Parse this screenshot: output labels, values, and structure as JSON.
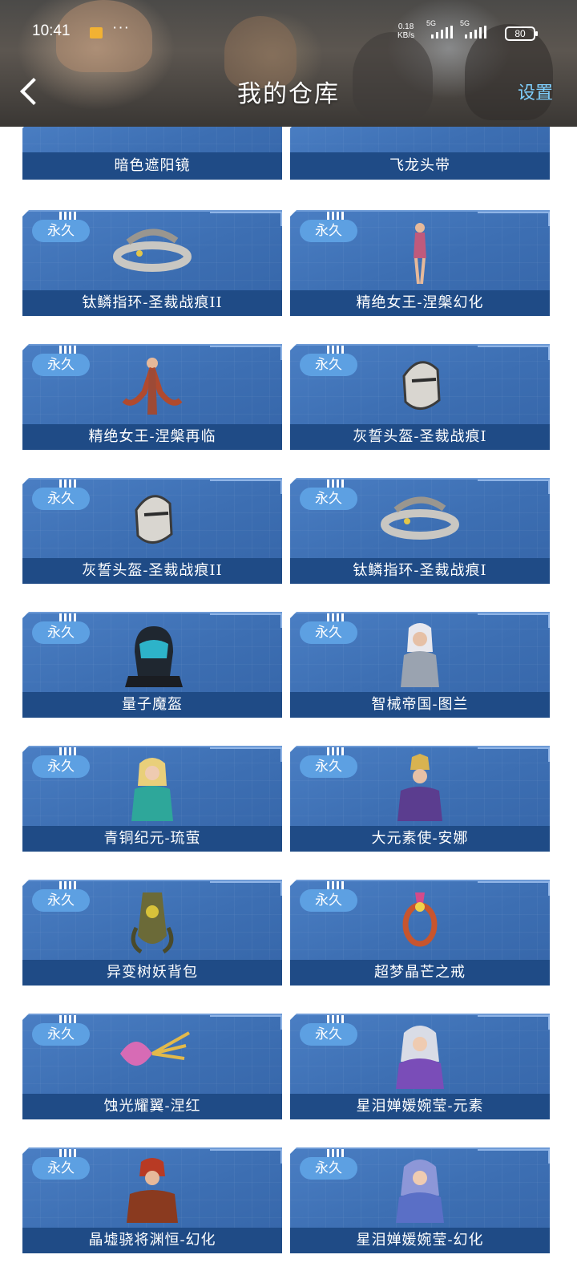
{
  "status": {
    "time": "10:41",
    "dots": "···",
    "speed_value": "0.18",
    "speed_unit": "KB/s",
    "network1": "5G",
    "network2": "5G",
    "battery": "80"
  },
  "header": {
    "title": "我的仓库",
    "settings": "设置"
  },
  "badge_label": "永久",
  "partial_items": [
    {
      "name": "暗色遮阳镜"
    },
    {
      "name": "飞龙头带"
    }
  ],
  "items": [
    {
      "name": "钛鳞指环-圣裁战痕II",
      "icon": "ring-icon"
    },
    {
      "name": "精绝女王-涅槃幻化",
      "icon": "character-icon"
    },
    {
      "name": "精绝女王-涅槃再临",
      "icon": "character-icon"
    },
    {
      "name": "灰誓头盔-圣裁战痕I",
      "icon": "helmet-icon"
    },
    {
      "name": "灰誓头盔-圣裁战痕II",
      "icon": "helmet-icon"
    },
    {
      "name": "钛鳞指环-圣裁战痕I",
      "icon": "ring-icon"
    },
    {
      "name": "量子魔盔",
      "icon": "helmet-icon"
    },
    {
      "name": "智械帝国-图兰",
      "icon": "character-icon"
    },
    {
      "name": "青铜纪元-琉萤",
      "icon": "character-icon"
    },
    {
      "name": "大元素使-安娜",
      "icon": "character-icon"
    },
    {
      "name": "异变树妖背包",
      "icon": "backpack-icon"
    },
    {
      "name": "超梦晶芒之戒",
      "icon": "ring-icon"
    },
    {
      "name": "蚀光耀翼-涅红",
      "icon": "wings-icon"
    },
    {
      "name": "星泪婵媛婉莹-元素",
      "icon": "character-icon"
    },
    {
      "name": "晶墟骁将渊恒-幻化",
      "icon": "character-icon"
    },
    {
      "name": "星泪婵媛婉莹-幻化",
      "icon": "character-icon"
    }
  ],
  "colors": {
    "card": "#3d6fb3",
    "label_bar": "#1f4b86",
    "badge": "#5da0e2",
    "settings": "#7fd0ff"
  }
}
